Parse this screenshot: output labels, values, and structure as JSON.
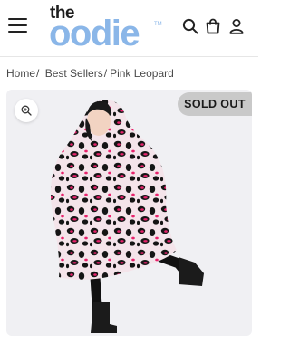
{
  "header": {
    "logo": {
      "line1": "the",
      "line2": "oodie",
      "tm": "TM"
    },
    "icons": {
      "menu": "menu-icon",
      "search": "search-icon",
      "cart": "shopping-bag-icon",
      "account": "user-icon"
    }
  },
  "breadcrumb": {
    "items": [
      {
        "label": "Home"
      },
      {
        "label": "Best Sellers"
      },
      {
        "label": "Pink Leopard"
      }
    ],
    "separator": "/"
  },
  "product": {
    "badge": "SOLD OUT",
    "zoom_icon": "zoom-in-icon",
    "image_alt": "Person wearing Pink Leopard oodie and black boots",
    "colors": {
      "print_base": "#f4e4ea",
      "pink": "#e8226c",
      "black": "#151515",
      "background": "#f0f0f3"
    }
  }
}
